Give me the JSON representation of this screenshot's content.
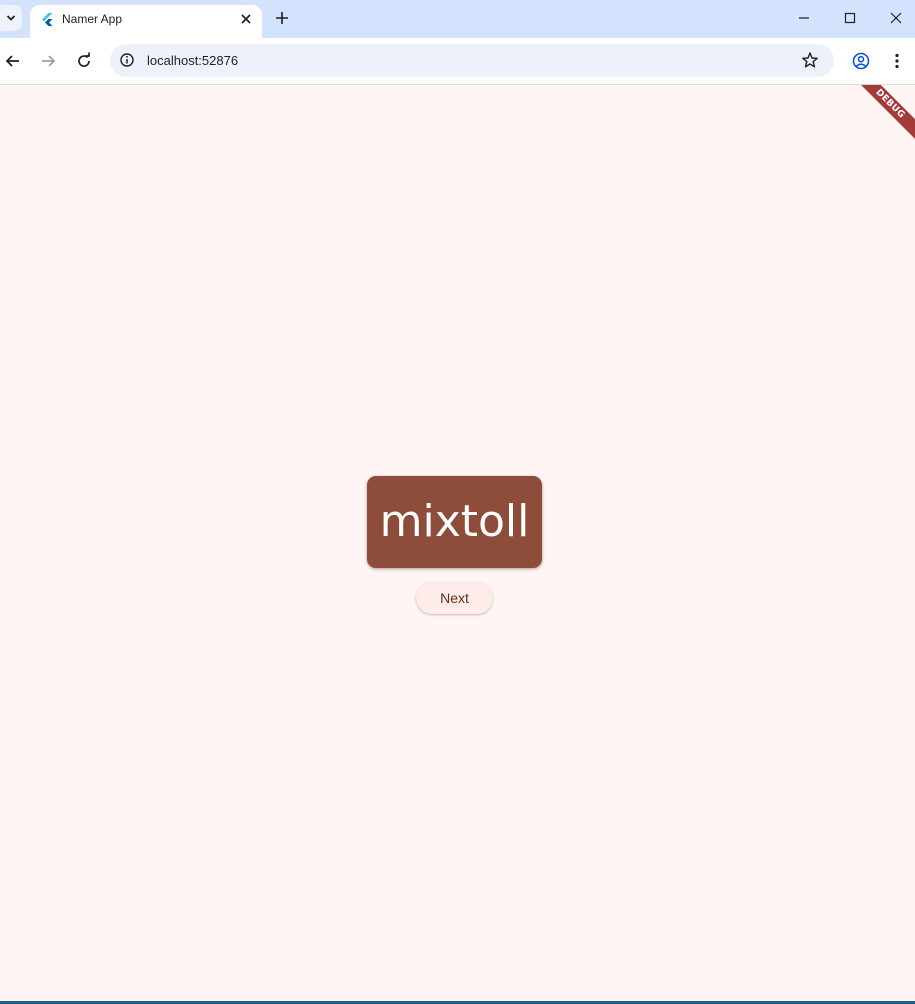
{
  "browser": {
    "tab": {
      "title": "Namer App"
    },
    "address_bar": {
      "url": "localhost:52876"
    }
  },
  "app": {
    "debug_banner": "DEBUG",
    "word_pair": "mixtoll",
    "next_button_label": "Next"
  },
  "colors": {
    "page_background": "#fff5f4",
    "card": "#8d4d3a",
    "button_text": "#6d2a1c",
    "tabstrip": "#d3e3fd"
  }
}
